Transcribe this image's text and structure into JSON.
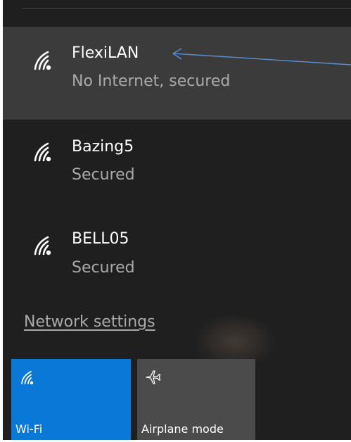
{
  "networks": [
    {
      "name": "FlexiLAN",
      "status": "No Internet, secured",
      "icon": "wifi-signal-icon"
    },
    {
      "name": "Bazing5",
      "status": "Secured",
      "icon": "wifi-signal-icon"
    },
    {
      "name": "BELL05",
      "status": "Secured",
      "icon": "wifi-signal-icon"
    }
  ],
  "network_settings": {
    "label": "Network settings"
  },
  "quick_actions": {
    "wifi": {
      "label": "Wi-Fi",
      "icon": "wifi-icon",
      "color": "#0a78d7"
    },
    "airplane": {
      "label": "Airplane mode",
      "icon": "airplane-icon",
      "color": "#4b4b4b"
    }
  },
  "colors": {
    "panel_bg": "#1f1f1f",
    "selected_bg": "#3b3b3b",
    "secondary_text": "#a9a9a9",
    "annotation_arrow": "#5b8fd6"
  }
}
